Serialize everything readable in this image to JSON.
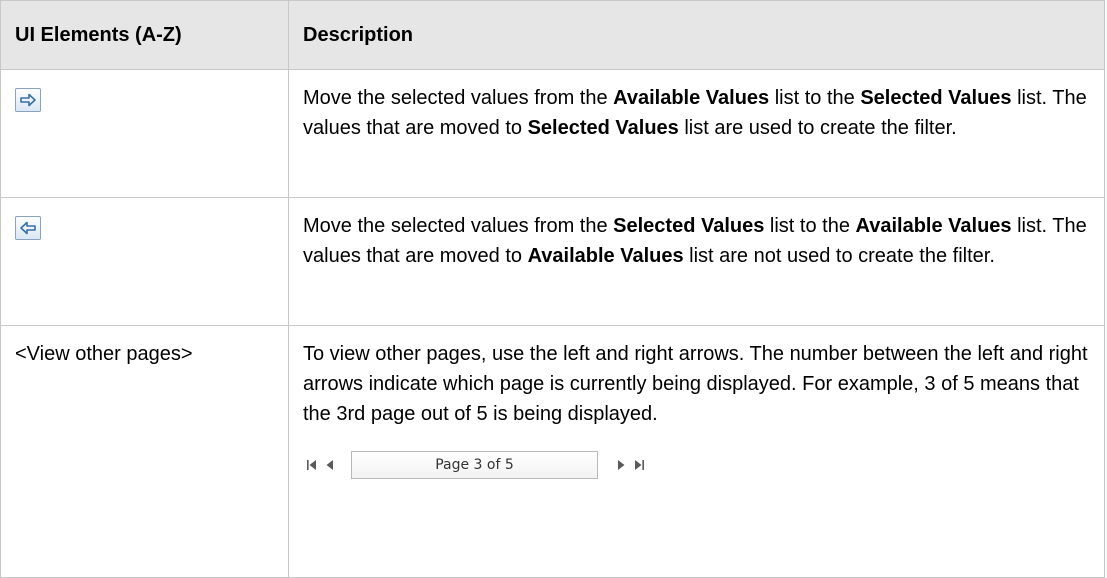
{
  "table": {
    "headers": {
      "ui_elements": "UI Elements (A-Z)",
      "description": "Description"
    },
    "rows": [
      {
        "ui_element_icon": "arrow-right-icon",
        "description": {
          "t1": "Move the selected values from the ",
          "b1": "Available Values",
          "t2": " list to the ",
          "b2": "Selected Values",
          "t3": " list. The values that are moved to ",
          "b3": "Selected Values",
          "t4": " list are used to create the filter."
        }
      },
      {
        "ui_element_icon": "arrow-left-icon",
        "description": {
          "t1": "Move the selected values from the ",
          "b1": "Selected Values",
          "t2": " list to the ",
          "b2": "Available Values",
          "t3": " list. The values that are moved to ",
          "b3": "Available Values",
          "t4": " list are not used to create the filter."
        }
      },
      {
        "ui_element_label": "<View other pages>",
        "description": {
          "text": "To view other pages, use the left and right arrows. The number between the left and right arrows indicate which page is currently being displayed. For example, 3 of 5 means that the 3rd page out of 5 is being displayed."
        },
        "pager": {
          "page_text": "Page 3 of 5",
          "icons": [
            "first-page-icon",
            "previous-page-icon",
            "next-page-icon",
            "last-page-icon"
          ]
        }
      }
    ]
  },
  "colors": {
    "header_background": "#e6e6e6",
    "border": "#c8c8c8",
    "icon_arrow": "#3a6ea5"
  }
}
